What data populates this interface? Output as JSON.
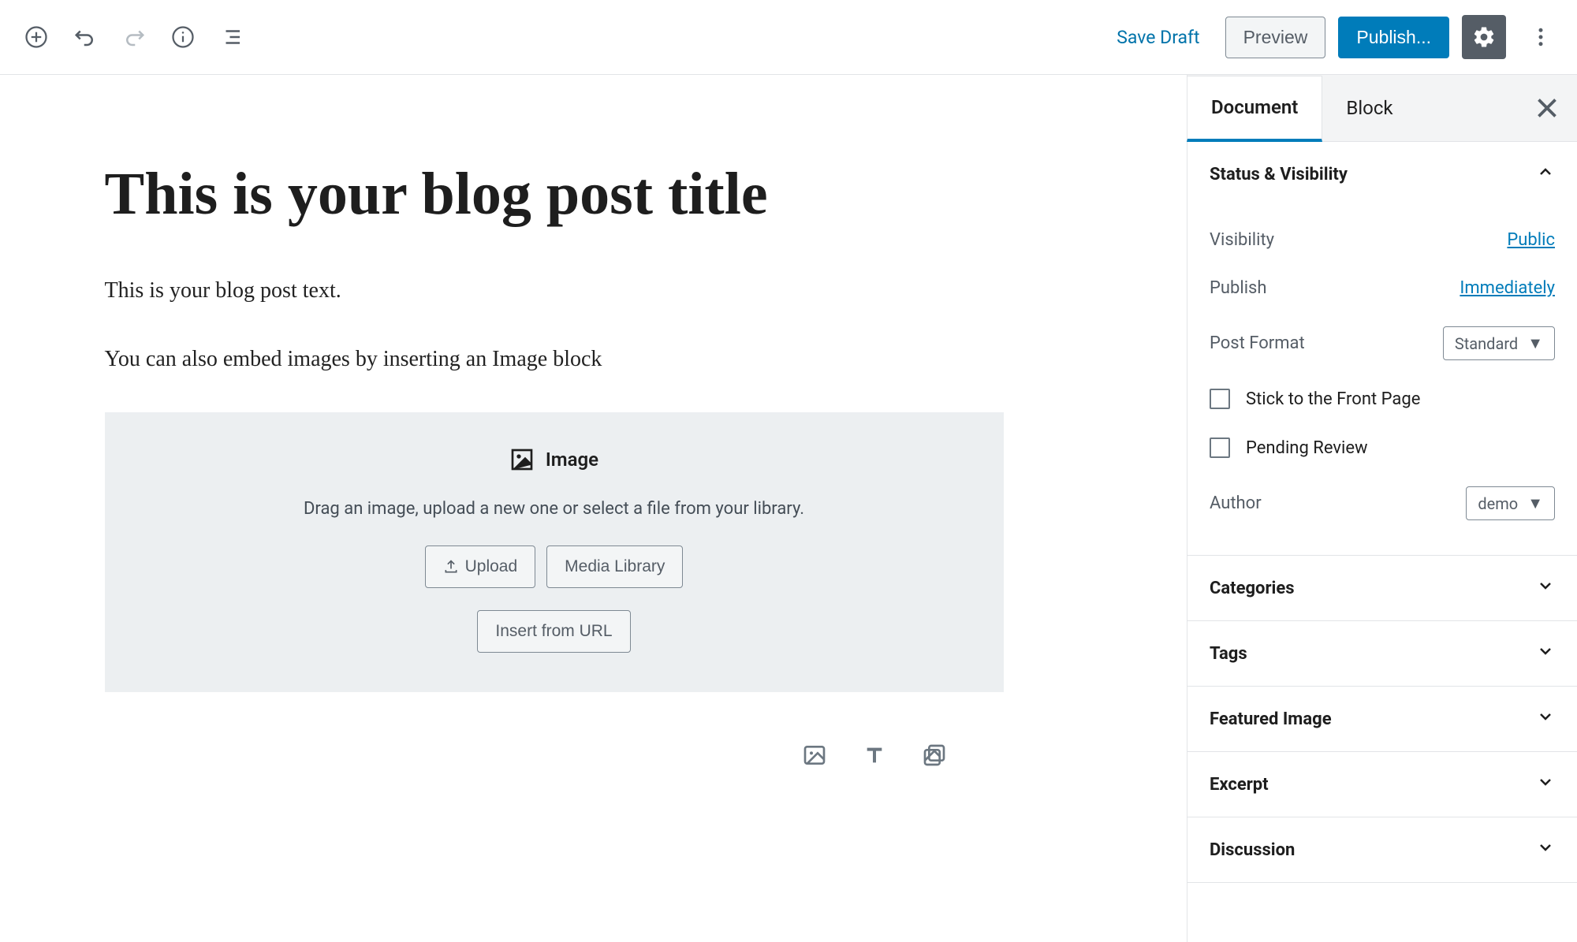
{
  "toolbar": {
    "save_draft": "Save Draft",
    "preview": "Preview",
    "publish": "Publish..."
  },
  "editor": {
    "title": "This is your blog post title",
    "para1": "This is your blog post text.",
    "para2": "You can also embed images by inserting an Image block",
    "image_block": {
      "label": "Image",
      "subtitle": "Drag an image, upload a new one or select a file from your library.",
      "upload": "Upload",
      "media_library": "Media Library",
      "insert_url": "Insert from URL"
    }
  },
  "sidebar": {
    "tabs": {
      "document": "Document",
      "block": "Block"
    },
    "status_visibility": {
      "title": "Status & Visibility",
      "visibility_label": "Visibility",
      "visibility_value": "Public",
      "publish_label": "Publish",
      "publish_value": "Immediately",
      "post_format_label": "Post Format",
      "post_format_value": "Standard",
      "stick_front": "Stick to the Front Page",
      "pending_review": "Pending Review",
      "author_label": "Author",
      "author_value": "demo"
    },
    "panels": {
      "categories": "Categories",
      "tags": "Tags",
      "featured_image": "Featured Image",
      "excerpt": "Excerpt",
      "discussion": "Discussion"
    }
  }
}
